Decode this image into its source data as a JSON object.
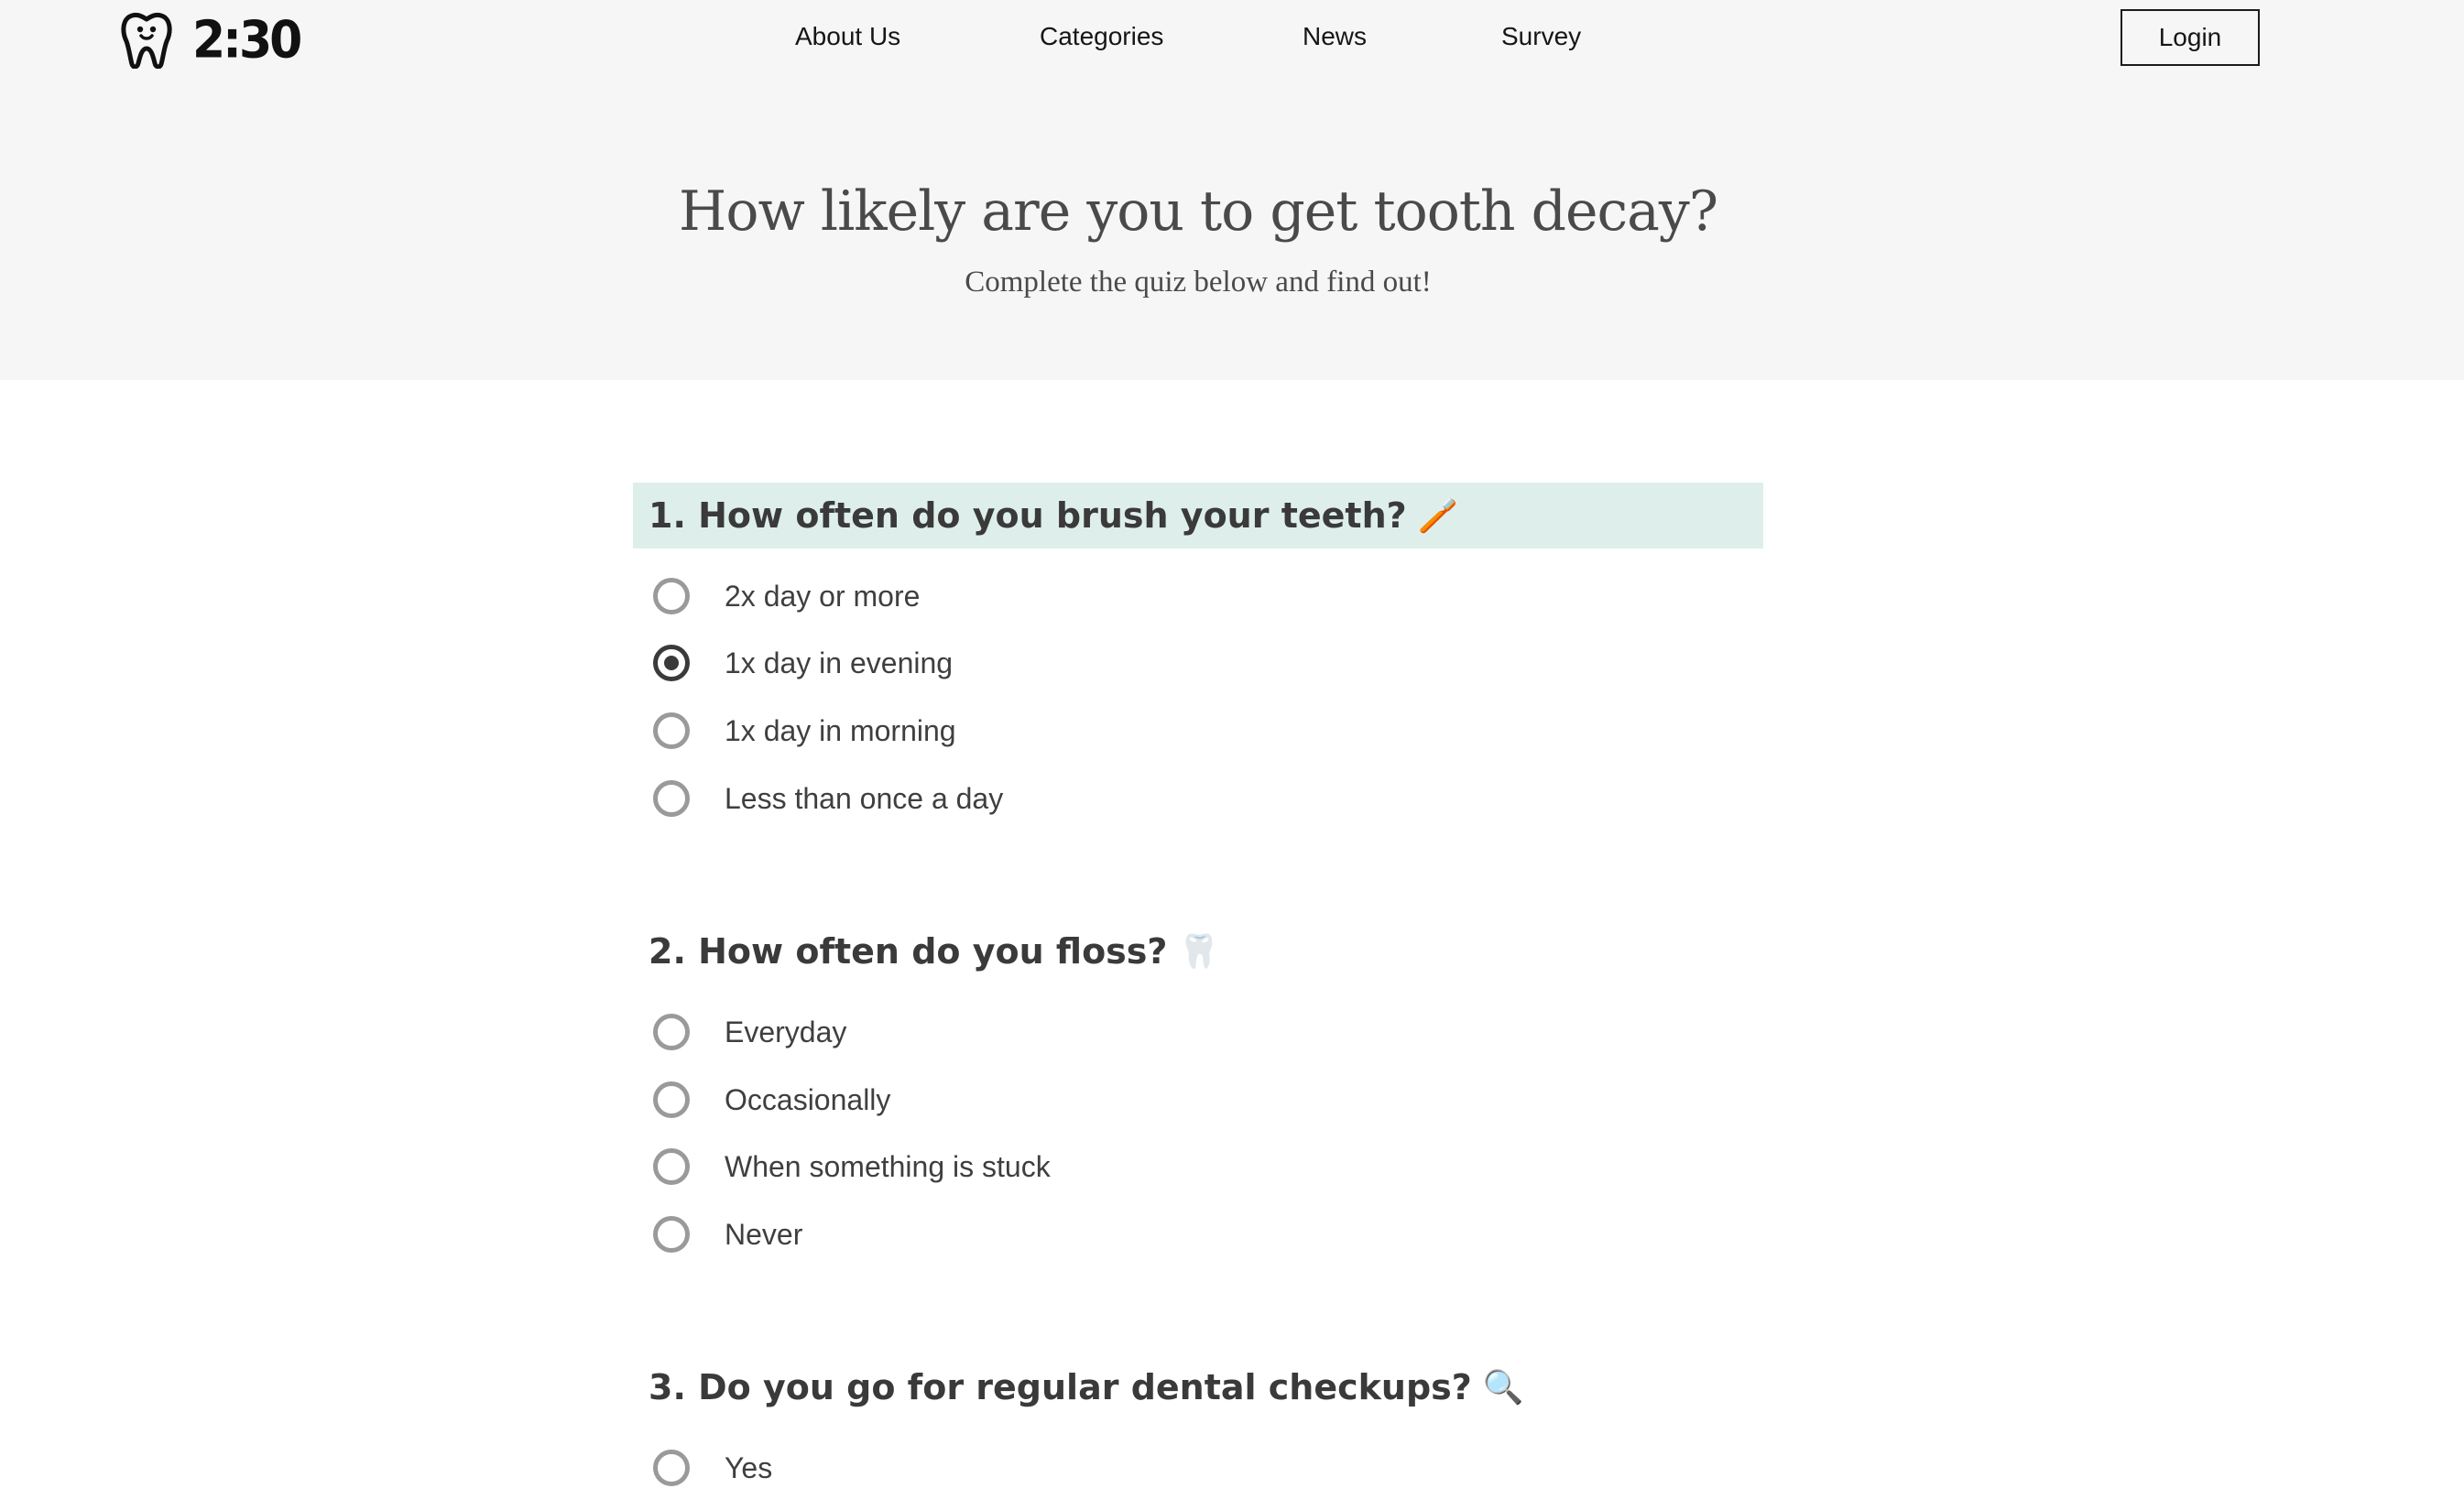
{
  "brand": {
    "name": "2:30",
    "logo_icon": "tooth-icon"
  },
  "nav": {
    "items": [
      {
        "label": "About Us"
      },
      {
        "label": "Categories"
      },
      {
        "label": "News"
      },
      {
        "label": "Survey"
      }
    ],
    "login_label": "Login"
  },
  "hero": {
    "title": "How likely are you to get tooth decay?",
    "subtitle": "Complete the quiz below and find out!"
  },
  "quiz": {
    "questions": [
      {
        "title": "1. How often do you brush your teeth?",
        "emoji": "🪥",
        "highlighted": true,
        "options": [
          {
            "label": "2x day or more",
            "selected": false
          },
          {
            "label": "1x day in evening",
            "selected": true
          },
          {
            "label": "1x day in morning",
            "selected": false
          },
          {
            "label": "Less than once a day",
            "selected": false
          }
        ]
      },
      {
        "title": "2. How often do you floss?",
        "emoji": "🦷",
        "highlighted": false,
        "options": [
          {
            "label": "Everyday",
            "selected": false
          },
          {
            "label": "Occasionally",
            "selected": false
          },
          {
            "label": "When something is stuck",
            "selected": false
          },
          {
            "label": "Never",
            "selected": false
          }
        ]
      },
      {
        "title": "3. Do you go for regular dental checkups?",
        "emoji": "🔍",
        "highlighted": false,
        "options": [
          {
            "label": "Yes",
            "selected": false
          }
        ]
      }
    ]
  },
  "colors": {
    "hero_bg": "#f6f6f6",
    "question_highlight": "#deefeb",
    "radio_border": "#9a9a9a",
    "radio_selected": "#3a3a3a"
  }
}
